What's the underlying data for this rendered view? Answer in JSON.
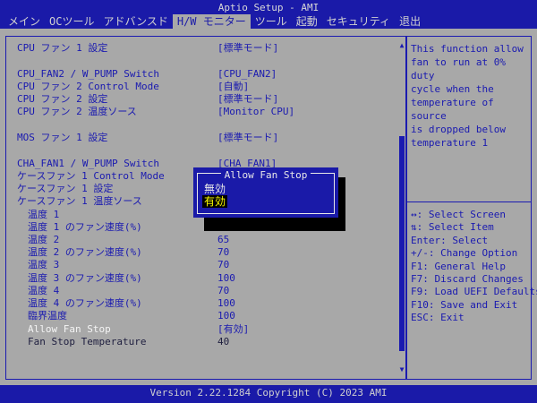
{
  "header": {
    "title": "Aptio Setup - AMI",
    "tabs": [
      "メイン",
      "OCツール",
      "アドバンスド",
      "H/W モニター",
      "ツール",
      "起動",
      "セキュリティ",
      "退出"
    ],
    "active_tab": "H/W モニター"
  },
  "settings": [
    {
      "label": "CPU ファン 1 設定",
      "value": "[標準モード]"
    },
    {
      "label": "CPU_FAN2 / W_PUMP Switch",
      "value": "[CPU_FAN2]"
    },
    {
      "label": "CPU ファン 2 Control Mode",
      "value": "[自動]"
    },
    {
      "label": "CPU ファン 2 設定",
      "value": "[標準モード]"
    },
    {
      "label": "CPU ファン 2 温度ソース",
      "value": "[Monitor CPU]"
    },
    {
      "label": "MOS ファン 1 設定",
      "value": "[標準モード]"
    },
    {
      "label": "CHA_FAN1 / W_PUMP Switch",
      "value": "[CHA_FAN1]"
    },
    {
      "label": "ケースファン 1 Control Mode",
      "value": ""
    },
    {
      "label": "ケースファン 1 設定",
      "value": ""
    },
    {
      "label": "ケースファン 1 温度ソース",
      "value": ""
    },
    {
      "label": "温度 1",
      "value": ""
    },
    {
      "label": "温度 1 のファン速度(%)",
      "value": ""
    },
    {
      "label": "温度 2",
      "value": "65"
    },
    {
      "label": "温度 2 のファン速度(%)",
      "value": "70"
    },
    {
      "label": "温度 3",
      "value": "70"
    },
    {
      "label": "温度 3 のファン速度(%)",
      "value": "100"
    },
    {
      "label": "温度 4",
      "value": "70"
    },
    {
      "label": "温度 4 のファン速度(%)",
      "value": "100"
    },
    {
      "label": "臨界温度",
      "value": "100"
    },
    {
      "label": "Allow Fan Stop",
      "value": "[有効]"
    },
    {
      "label": "Fan Stop Temperature",
      "value": "40"
    }
  ],
  "help": {
    "description": "This function allow\nfan to run at 0% duty\ncycle when the\ntemperature of source\nis dropped below\ntemperature 1",
    "keys": [
      "↔: Select Screen",
      "⇅: Select Item",
      "Enter: Select",
      "+/-: Change Option",
      "F1: General Help",
      "F7: Discard Changes",
      "F9: Load UEFI Defaults",
      "F10: Save and Exit",
      "ESC: Exit"
    ]
  },
  "popup": {
    "title": "Allow Fan Stop",
    "options": [
      "無効",
      "有効"
    ],
    "selected": "有効"
  },
  "footer": {
    "version": "Version 2.22.1284 Copyright (C) 2023 AMI"
  },
  "scroll": {
    "up_icon": "▲",
    "down_icon": "▼"
  }
}
